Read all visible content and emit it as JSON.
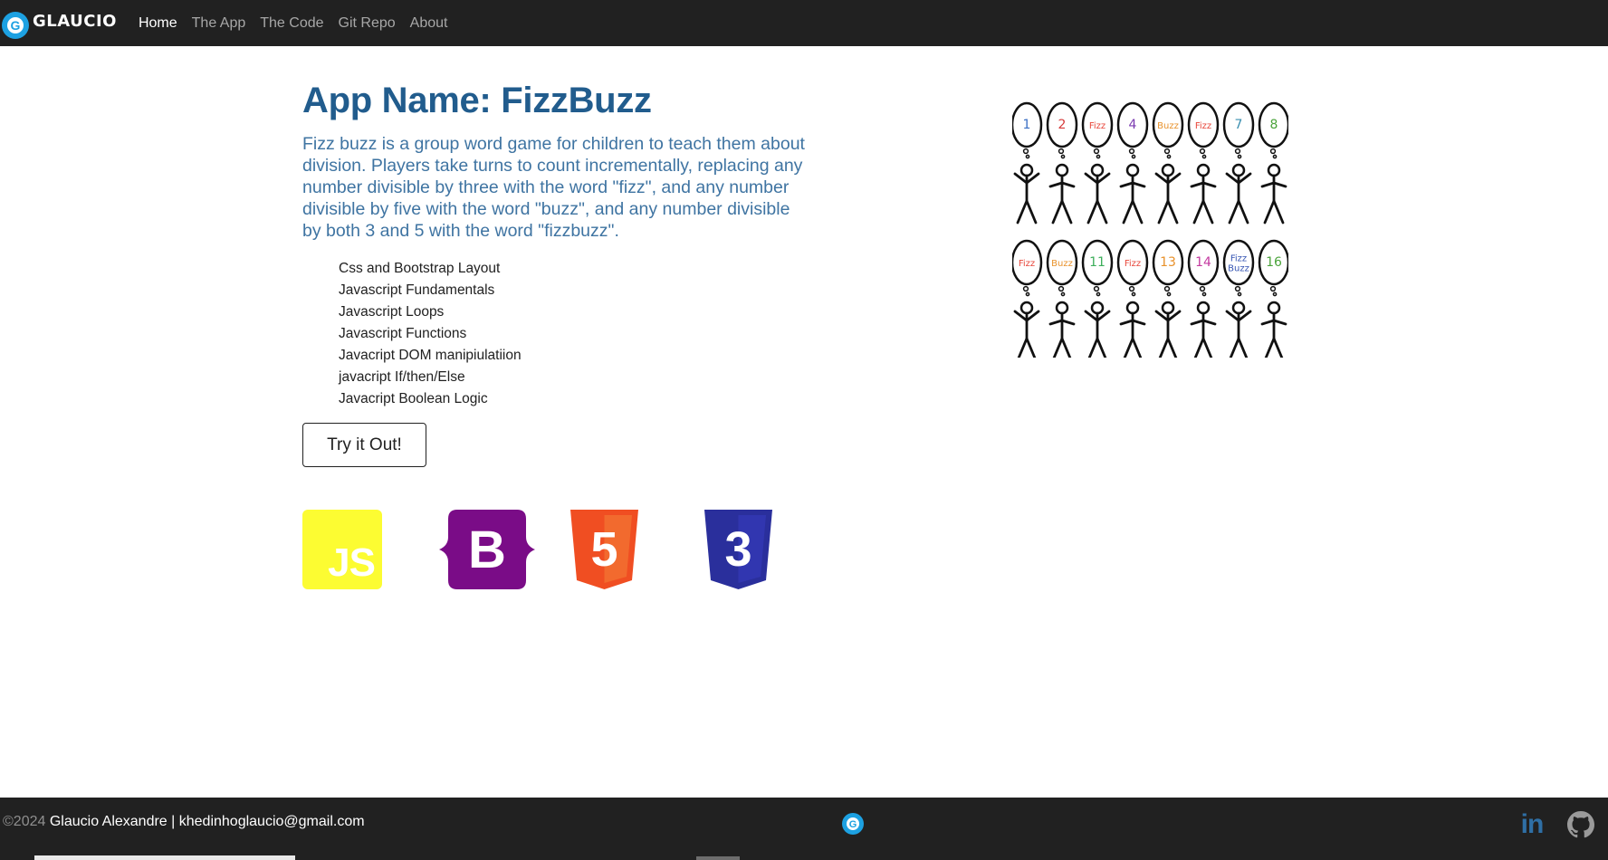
{
  "nav": {
    "brand_text": "GLAUCIO",
    "brand_logo_letter": "G",
    "items": [
      {
        "label": "Home",
        "active": true
      },
      {
        "label": "The App",
        "active": false
      },
      {
        "label": "The Code",
        "active": false
      },
      {
        "label": "Git Repo",
        "active": false
      },
      {
        "label": "About",
        "active": false
      }
    ]
  },
  "main": {
    "title": "App Name: FizzBuzz",
    "description": "Fizz buzz is a group word game for children to teach them about division. Players take turns to count incrementally, replacing any number divisible by three with the word \"fizz\", and any number divisible by five with the word \"buzz\", and any number divisible by both 3 and 5 with the word \"fizzbuzz\".",
    "skills": [
      "Css and Bootstrap Layout",
      "Javascript Fundamentals",
      "Javascript Loops",
      "Javascript Functions",
      "Javacript DOM manipiulatiion",
      "javacript If/then/Else",
      "Javacript Boolean Logic"
    ],
    "button_label": "Try it Out!"
  },
  "tech_logos": {
    "js_text": "JS",
    "bootstrap_text": "B",
    "html_text": "5",
    "css_text": "3"
  },
  "art": {
    "row1": [
      "1",
      "2",
      "Fizz",
      "4",
      "Buzz",
      "Fizz",
      "7",
      "8"
    ],
    "row2": [
      "Fizz",
      "Buzz",
      "11",
      "Fizz",
      "13",
      "14",
      "Fizz Buzz",
      "16"
    ]
  },
  "footer": {
    "copyright": "©2024",
    "author": "Glaucio Alexandre | khedinhoglaucio@gmail.com",
    "linkedin_text": "in"
  },
  "colors": {
    "navbar_bg": "#212121",
    "title": "#215c8d",
    "description": "#3f74a2",
    "brand_blue": "#1da1e2",
    "js_yellow": "#fcfc32",
    "bootstrap_purple": "#7a0c87",
    "html_orange": "#f04e22",
    "css_blue": "#2a2f9c"
  }
}
